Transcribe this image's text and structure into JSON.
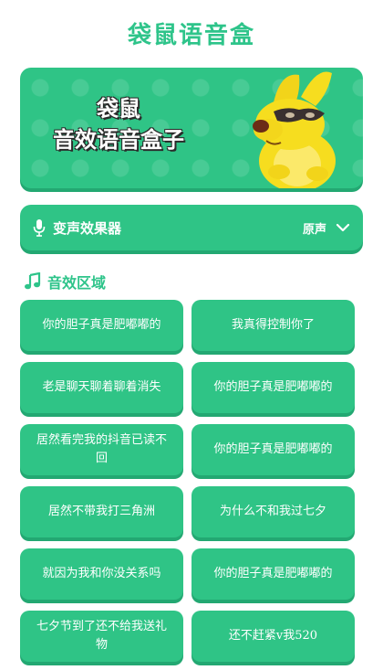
{
  "app": {
    "title": "袋鼠语音盒"
  },
  "banner": {
    "line1": "袋鼠",
    "line2": "音效语音盒子"
  },
  "effect": {
    "label": "变声效果器",
    "value": "原声"
  },
  "section": {
    "title": "音效区域"
  },
  "sounds": [
    "你的胆子真是肥嘟嘟的",
    "我真得控制你了",
    "老是聊天聊着聊着消失",
    "你的胆子真是肥嘟嘟的",
    "居然看完我的抖音已读不回",
    "你的胆子真是肥嘟嘟的",
    "居然不带我打三角洲",
    "为什么不和我过七夕",
    "就因为我和你没关系吗",
    "你的胆子真是肥嘟嘟的",
    "七夕节到了还不给我送礼物",
    "还不赶紧v我520"
  ],
  "colors": {
    "accent": "#2ec48a",
    "button": "#2fc486",
    "button_shadow": "#23a872"
  },
  "icons": {
    "mic": "microphone-icon",
    "chevron": "chevron-down-icon",
    "note": "music-note-icon"
  }
}
